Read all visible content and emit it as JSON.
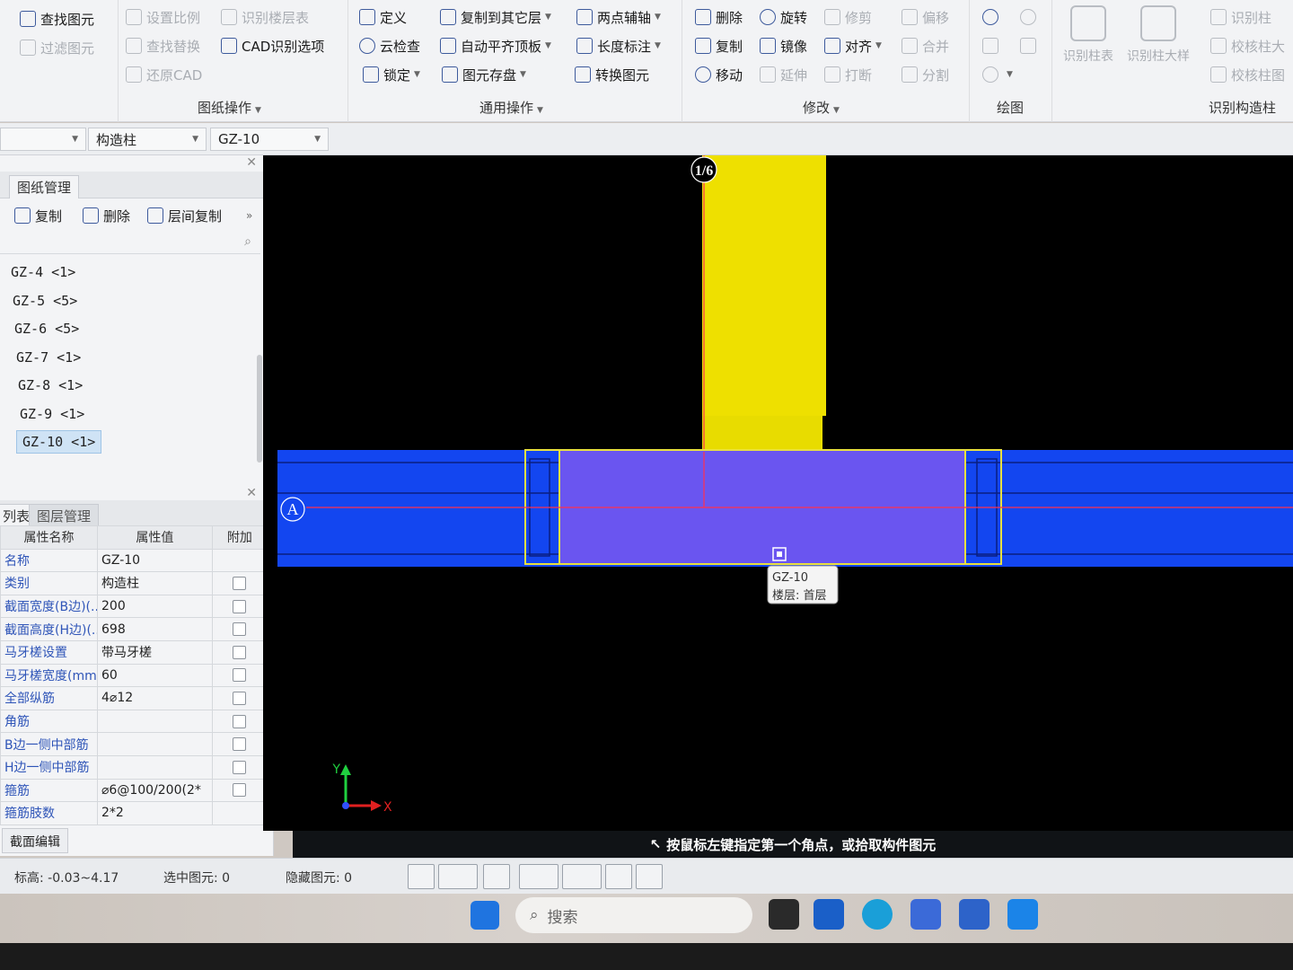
{
  "ribbon": {
    "group1": {
      "items": [
        "查找图元",
        "过滤图元"
      ],
      "title": ""
    },
    "group2": {
      "items": [
        "设置比例",
        "识别楼层表",
        "查找替换",
        "CAD识别选项",
        "还原CAD"
      ],
      "title": "图纸操作"
    },
    "group3": {
      "items": [
        "定义",
        "复制到其它层",
        "两点辅轴",
        "云检查",
        "自动平齐顶板",
        "长度标注",
        "锁定",
        "图元存盘",
        "转换图元"
      ],
      "title": "通用操作"
    },
    "group4": {
      "items": [
        "删除",
        "旋转",
        "修剪",
        "偏移",
        "复制",
        "镜像",
        "对齐",
        "合并",
        "移动",
        "延伸",
        "打断",
        "分割"
      ],
      "title": "修改"
    },
    "group5": {
      "title": "绘图"
    },
    "group6": {
      "big": [
        "识别柱表",
        "识别柱大样"
      ],
      "items": [
        "识别柱",
        "校核柱大",
        "校核柱图"
      ],
      "title": "识别构造柱"
    }
  },
  "selectors": {
    "type": "构造柱",
    "name": "GZ-10"
  },
  "drawing_panel": {
    "tab": "图纸管理",
    "tools": [
      "复制",
      "删除",
      "层间复制"
    ],
    "list": [
      "GZ-4 <1>",
      "GZ-5 <5>",
      "GZ-6 <5>",
      "GZ-7 <1>",
      "GZ-8 <1>",
      "GZ-9 <1>",
      "GZ-10 <1>"
    ]
  },
  "props_panel": {
    "tabs": [
      "列表",
      "图层管理"
    ],
    "headers": [
      "属性名称",
      "属性值",
      "附加"
    ],
    "rows": [
      {
        "name": "名称",
        "value": "GZ-10"
      },
      {
        "name": "类别",
        "value": "构造柱"
      },
      {
        "name": "截面宽度(B边)(...",
        "value": "200"
      },
      {
        "name": "截面高度(H边)(...",
        "value": "698"
      },
      {
        "name": "马牙槎设置",
        "value": "带马牙槎"
      },
      {
        "name": "马牙槎宽度(mm)",
        "value": "60"
      },
      {
        "name": "全部纵筋",
        "value": "4⌀12"
      },
      {
        "name": "角筋",
        "value": ""
      },
      {
        "name": "B边一侧中部筋",
        "value": ""
      },
      {
        "name": "H边一侧中部筋",
        "value": ""
      },
      {
        "name": "箍筋",
        "value": "⌀6@100/200(2*"
      },
      {
        "name": "箍筋肢数",
        "value": "2*2"
      }
    ],
    "section_edit": "截面编辑"
  },
  "canvas": {
    "axis_top": "1/6",
    "axis_left": "A",
    "tooltip": {
      "name": "GZ-10",
      "floor": "楼层: 首层"
    },
    "axis_x": "X",
    "axis_y": "Y",
    "colors": {
      "wall": "#1a4ff0",
      "column": "#6a55f0",
      "beam": "#f0e000",
      "select": "#e8e040"
    }
  },
  "hint": "按鼠标左键指定第一个角点，或拾取构件图元",
  "status": {
    "elevation": "标高:  -0.03~4.17",
    "selected": "选中图元:  0",
    "hidden": "隐藏图元:  0"
  },
  "taskbar": {
    "search": "搜索"
  }
}
